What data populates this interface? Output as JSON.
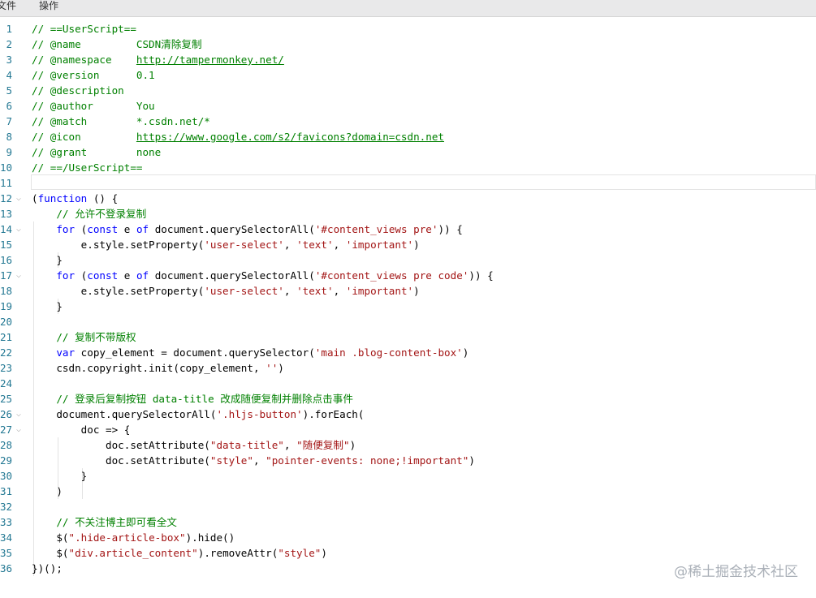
{
  "menubar": {
    "file": "文件",
    "operate": "操作"
  },
  "fold_marker": "⌵",
  "editor": {
    "lines": [
      {
        "n": "1",
        "t": [
          [
            "// ==UserScript==",
            "cm"
          ]
        ]
      },
      {
        "n": "2",
        "t": [
          [
            "// @name         CSDN清除复制",
            "cm"
          ]
        ]
      },
      {
        "n": "3",
        "t": [
          [
            "// @namespace    ",
            "cm"
          ],
          [
            "http://tampermonkey.net/",
            "cm lk"
          ]
        ]
      },
      {
        "n": "4",
        "t": [
          [
            "// @version      0.1",
            "cm"
          ]
        ]
      },
      {
        "n": "5",
        "t": [
          [
            "// @description",
            "cm"
          ]
        ]
      },
      {
        "n": "6",
        "t": [
          [
            "// @author       You",
            "cm"
          ]
        ]
      },
      {
        "n": "7",
        "t": [
          [
            "// @match        *.csdn.net/*",
            "cm"
          ]
        ]
      },
      {
        "n": "8",
        "t": [
          [
            "// @icon         ",
            "cm"
          ],
          [
            "https://www.google.com/s2/favicons?domain=csdn.net",
            "cm lk"
          ]
        ]
      },
      {
        "n": "9",
        "t": [
          [
            "// @grant        none",
            "cm"
          ]
        ]
      },
      {
        "n": "10",
        "t": [
          [
            "// ==/UserScript==",
            "cm"
          ]
        ]
      },
      {
        "n": "11",
        "t": [],
        "current": true
      },
      {
        "n": "12",
        "t": [
          [
            "(",
            ""
          ],
          [
            "function",
            "kw"
          ],
          [
            " () {",
            ""
          ]
        ],
        "fold": true
      },
      {
        "n": "13",
        "t": [
          [
            "    ",
            ""
          ],
          [
            "// 允许不登录复制",
            "cm"
          ]
        ]
      },
      {
        "n": "14",
        "t": [
          [
            "    ",
            ""
          ],
          [
            "for",
            "kw"
          ],
          [
            " (",
            ""
          ],
          [
            "const",
            "kw"
          ],
          [
            " e ",
            ""
          ],
          [
            "of",
            "kw"
          ],
          [
            " document.querySelectorAll(",
            ""
          ],
          [
            "'#content_views pre'",
            "st"
          ],
          [
            ")) {",
            ""
          ]
        ],
        "fold": true
      },
      {
        "n": "15",
        "t": [
          [
            "        e.style.setProperty(",
            ""
          ],
          [
            "'user-select'",
            "st"
          ],
          [
            ", ",
            ""
          ],
          [
            "'text'",
            "st"
          ],
          [
            ", ",
            ""
          ],
          [
            "'important'",
            "st"
          ],
          [
            ")",
            ""
          ]
        ]
      },
      {
        "n": "16",
        "t": [
          [
            "    }",
            ""
          ]
        ]
      },
      {
        "n": "17",
        "t": [
          [
            "    ",
            ""
          ],
          [
            "for",
            "kw"
          ],
          [
            " (",
            ""
          ],
          [
            "const",
            "kw"
          ],
          [
            " e ",
            ""
          ],
          [
            "of",
            "kw"
          ],
          [
            " document.querySelectorAll(",
            ""
          ],
          [
            "'#content_views pre code'",
            "st"
          ],
          [
            ")) {",
            ""
          ]
        ],
        "fold": true
      },
      {
        "n": "18",
        "t": [
          [
            "        e.style.setProperty(",
            ""
          ],
          [
            "'user-select'",
            "st"
          ],
          [
            ", ",
            ""
          ],
          [
            "'text'",
            "st"
          ],
          [
            ", ",
            ""
          ],
          [
            "'important'",
            "st"
          ],
          [
            ")",
            ""
          ]
        ]
      },
      {
        "n": "19",
        "t": [
          [
            "    }",
            ""
          ]
        ]
      },
      {
        "n": "20",
        "t": []
      },
      {
        "n": "21",
        "t": [
          [
            "    ",
            ""
          ],
          [
            "// 复制不带版权",
            "cm"
          ]
        ]
      },
      {
        "n": "22",
        "t": [
          [
            "    ",
            ""
          ],
          [
            "var",
            "kw"
          ],
          [
            " copy_element = document.querySelector(",
            ""
          ],
          [
            "'main .blog-content-box'",
            "st"
          ],
          [
            ")",
            ""
          ]
        ]
      },
      {
        "n": "23",
        "t": [
          [
            "    csdn.copyright.init(copy_element, ",
            ""
          ],
          [
            "''",
            "st"
          ],
          [
            ")",
            ""
          ]
        ]
      },
      {
        "n": "24",
        "t": []
      },
      {
        "n": "25",
        "t": [
          [
            "    ",
            ""
          ],
          [
            "// 登录后复制按钮 data-title 改成随便复制并删除点击事件",
            "cm"
          ]
        ]
      },
      {
        "n": "26",
        "t": [
          [
            "    document.querySelectorAll(",
            ""
          ],
          [
            "'.hljs-button'",
            "st"
          ],
          [
            ").forEach(",
            ""
          ]
        ],
        "fold": true
      },
      {
        "n": "27",
        "t": [
          [
            "        doc => {",
            ""
          ]
        ],
        "fold": true
      },
      {
        "n": "28",
        "t": [
          [
            "            doc.setAttribute(",
            ""
          ],
          [
            "\"data-title\"",
            "st"
          ],
          [
            ", ",
            ""
          ],
          [
            "\"随便复制\"",
            "st"
          ],
          [
            ")",
            ""
          ]
        ]
      },
      {
        "n": "29",
        "t": [
          [
            "            doc.setAttribute(",
            ""
          ],
          [
            "\"style\"",
            "st"
          ],
          [
            ", ",
            ""
          ],
          [
            "\"pointer-events: none;!important\"",
            "st"
          ],
          [
            ")",
            ""
          ]
        ]
      },
      {
        "n": "30",
        "t": [
          [
            "        }",
            ""
          ]
        ]
      },
      {
        "n": "31",
        "t": [
          [
            "    )",
            ""
          ]
        ]
      },
      {
        "n": "32",
        "t": []
      },
      {
        "n": "33",
        "t": [
          [
            "    ",
            ""
          ],
          [
            "// 不关注博主即可看全文",
            "cm"
          ]
        ]
      },
      {
        "n": "34",
        "t": [
          [
            "    $(",
            ""
          ],
          [
            "\".hide-article-box\"",
            "st"
          ],
          [
            ").hide()",
            ""
          ]
        ]
      },
      {
        "n": "35",
        "t": [
          [
            "    $(",
            ""
          ],
          [
            "\"div.article_content\"",
            "st"
          ],
          [
            ").removeAttr(",
            ""
          ],
          [
            "\"style\"",
            "st"
          ],
          [
            ")",
            ""
          ]
        ]
      },
      {
        "n": "36",
        "t": [
          [
            "})();",
            ""
          ]
        ]
      }
    ]
  },
  "watermark": "@稀土掘金技术社区"
}
